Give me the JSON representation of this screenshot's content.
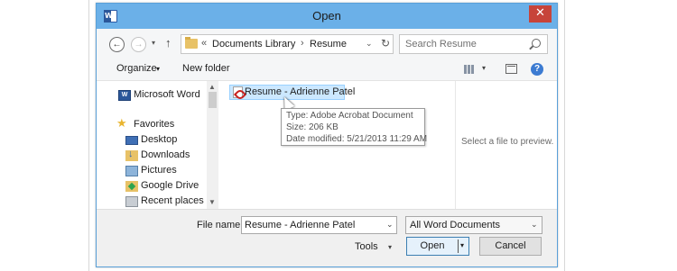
{
  "window": {
    "title": "Open",
    "close_glyph": "✕"
  },
  "address_bar": {
    "back_glyph": "←",
    "forward_glyph": "→",
    "history_glyph": "▾",
    "up_glyph": "↑",
    "crumb_prefix": "«",
    "crumbs": [
      "Documents Library",
      "Resume"
    ],
    "crumb_separator": "›",
    "dropdown_glyph": "⌄",
    "refresh_glyph": "↻"
  },
  "search": {
    "placeholder": "Search Resume"
  },
  "command_bar": {
    "organize": "Organize",
    "organize_glyph": "▾",
    "new_folder": "New folder",
    "view_glyph": "▾",
    "help_glyph": "?"
  },
  "nav_pane": {
    "items": [
      {
        "label": "Microsoft Word",
        "icon": "word-icon"
      },
      {
        "label": "Favorites",
        "icon": "star-icon"
      },
      {
        "label": "Desktop",
        "icon": "desktop-icon"
      },
      {
        "label": "Downloads",
        "icon": "downloads-icon"
      },
      {
        "label": "Pictures",
        "icon": "pictures-icon"
      },
      {
        "label": "Google Drive",
        "icon": "google-drive-icon"
      },
      {
        "label": "Recent places",
        "icon": "recent-places-icon"
      }
    ],
    "scroll_up_glyph": "▲",
    "scroll_down_glyph": "▼"
  },
  "file_list": {
    "files": [
      {
        "name": "Resume - Adrienne Patel",
        "icon": "pdf-icon",
        "selected": true
      }
    ]
  },
  "tooltip": {
    "type": "Type: Adobe Acrobat Document",
    "size": "Size: 206 KB",
    "modified": "Date modified: 5/21/2013 11:29 AM"
  },
  "preview": {
    "message": "Select a file to preview."
  },
  "footer": {
    "file_name_label": "File name:",
    "file_name_value": "Resume - Adrienne Patel",
    "file_name_drop_glyph": "⌄",
    "file_type_value": "All Word Documents",
    "file_type_drop_glyph": "⌄",
    "tools_label": "Tools",
    "tools_drop_glyph": "▾",
    "open_label": "Open",
    "open_drop_glyph": "▾",
    "cancel_label": "Cancel"
  },
  "colors": {
    "titlebar": "#6bb0e8",
    "close_button": "#c7443a",
    "selection": "#cce8ff",
    "open_button_border": "#3c7fb1"
  }
}
